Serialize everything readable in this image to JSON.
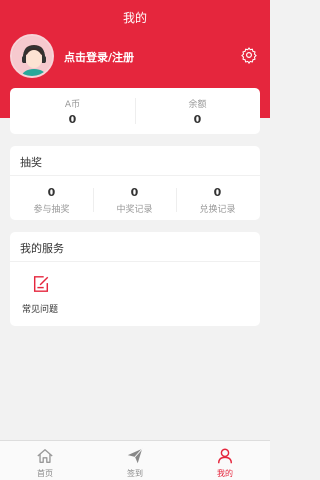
{
  "header": {
    "title": "我的",
    "login_text": "点击登录/注册"
  },
  "balance": [
    {
      "label": "A币",
      "value": "0"
    },
    {
      "label": "余额",
      "value": "0"
    }
  ],
  "lottery": {
    "title": "抽奖",
    "items": [
      {
        "value": "0",
        "label": "参与抽奖"
      },
      {
        "value": "0",
        "label": "中奖记录"
      },
      {
        "value": "0",
        "label": "兑换记录"
      }
    ]
  },
  "services": {
    "title": "我的服务",
    "items": [
      {
        "label": "常见问题",
        "icon": "edit-note-icon"
      }
    ]
  },
  "tabbar": [
    {
      "label": "首页",
      "icon": "home-icon"
    },
    {
      "label": "签到",
      "icon": "paper-plane-icon"
    },
    {
      "label": "我的",
      "icon": "user-icon",
      "active": true
    }
  ],
  "colors": {
    "primary": "#e5263d",
    "background": "#f2f2f2"
  }
}
